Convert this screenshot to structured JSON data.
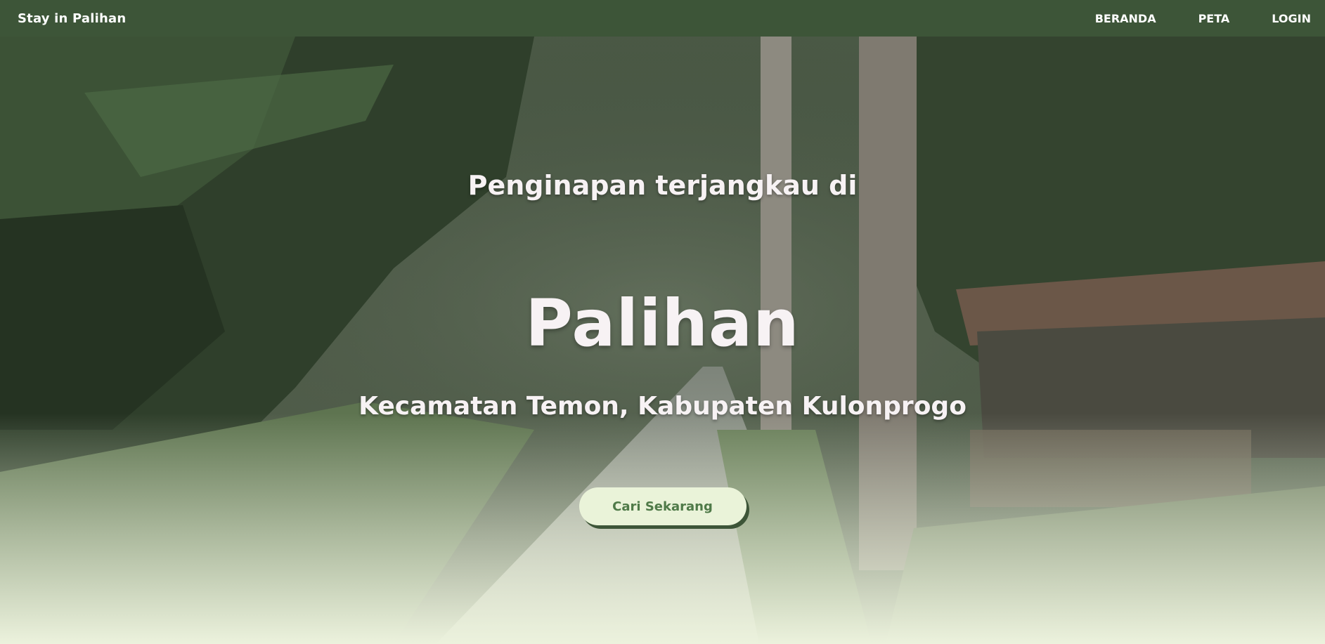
{
  "navbar": {
    "brand": "Stay in Palihan",
    "links": [
      {
        "label": "BERANDA"
      },
      {
        "label": "PETA"
      },
      {
        "label": "LOGIN"
      }
    ]
  },
  "hero": {
    "subtitle": "Penginapan terjangkau di",
    "title": "Palihan",
    "location": "Kecamatan Temon, Kabupaten Kulonprogo",
    "cta_label": "Cari Sekarang",
    "background": "village-path-photo"
  },
  "colors": {
    "navbar_bg": "#3d5538",
    "cta_bg": "#eaf3d9",
    "cta_text": "#4f7a48",
    "hero_text": "#f7f2f4"
  }
}
